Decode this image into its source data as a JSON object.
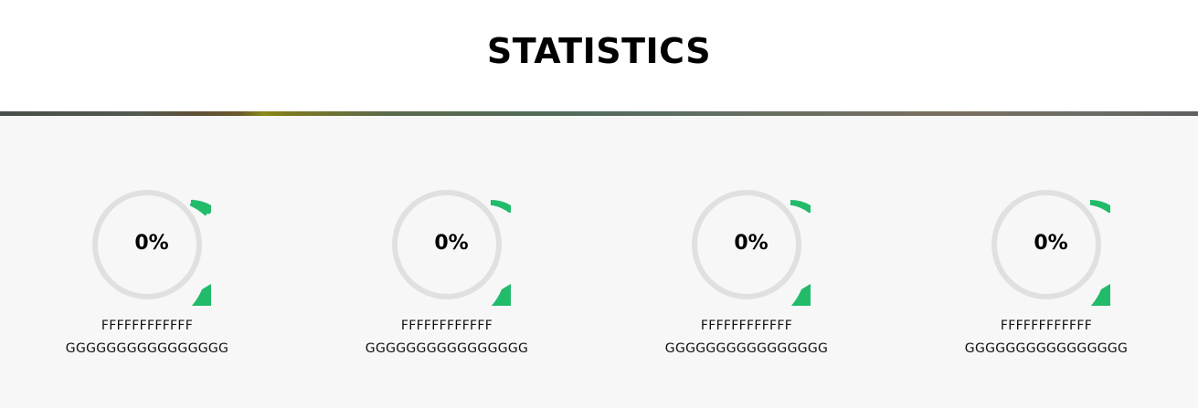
{
  "section": {
    "title": "STATISTICS"
  },
  "colors": {
    "ring_track": "#e0e0e0",
    "ring_progress": "#21bb6a",
    "background": "#f7f7f7"
  },
  "stats": [
    {
      "percent_label": "0%",
      "line1": "FFFFFFFFFFFF",
      "line2": "GGGGGGGGGGGGGGGG"
    },
    {
      "percent_label": "0%",
      "line1": "FFFFFFFFFFFF",
      "line2": "GGGGGGGGGGGGGGGG"
    },
    {
      "percent_label": "0%",
      "line1": "FFFFFFFFFFFF",
      "line2": "GGGGGGGGGGGGGGGG"
    },
    {
      "percent_label": "0%",
      "line1": "FFFFFFFFFFFF",
      "line2": "GGGGGGGGGGGGGGGG"
    }
  ]
}
